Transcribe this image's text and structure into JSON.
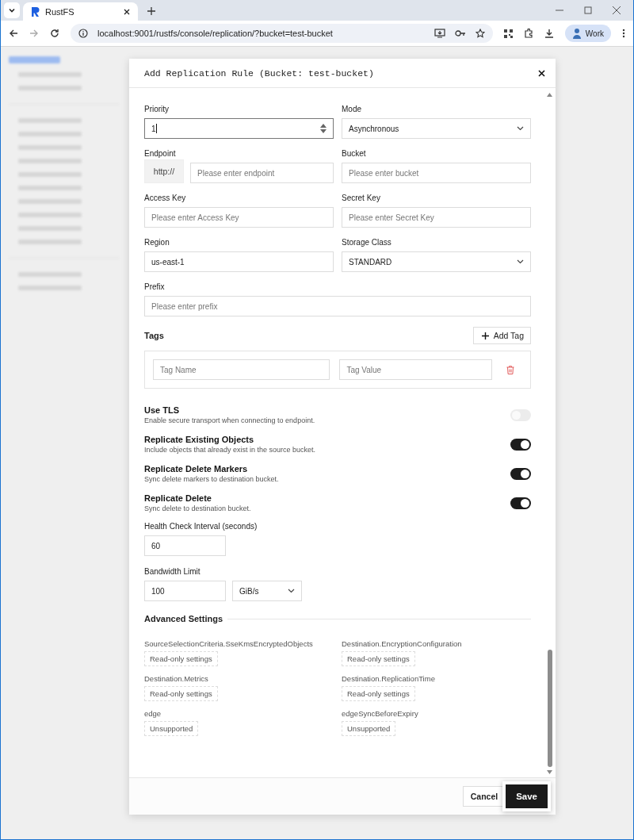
{
  "browser": {
    "tab_title": "RustFS",
    "url": "localhost:9001/rustfs/console/replication/?bucket=test-bucket",
    "profile": "Work"
  },
  "dialog": {
    "title": "Add Replication Rule (Bucket: test-bucket)",
    "field_rows": [
      [
        {
          "kind": "number",
          "label": "Priority",
          "value": "1"
        },
        {
          "kind": "select",
          "label": "Mode",
          "value": "Asynchronous"
        }
      ],
      [
        {
          "kind": "prefixed",
          "label": "Endpoint",
          "prefix": "http://",
          "placeholder": "Please enter endpoint"
        },
        {
          "kind": "text",
          "label": "Bucket",
          "placeholder": "Please enter bucket"
        }
      ],
      [
        {
          "kind": "text",
          "label": "Access Key",
          "placeholder": "Please enter Access Key"
        },
        {
          "kind": "text",
          "label": "Secret Key",
          "placeholder": "Please enter Secret Key"
        }
      ],
      [
        {
          "kind": "text",
          "label": "Region",
          "value": "us-east-1"
        },
        {
          "kind": "select",
          "label": "Storage Class",
          "value": "STANDARD"
        }
      ],
      [
        {
          "kind": "text",
          "label": "Prefix",
          "placeholder": "Please enter prefix"
        }
      ]
    ],
    "tags": {
      "title": "Tags",
      "add_button": "Add Tag",
      "rows": [
        {
          "name_placeholder": "Tag Name",
          "value_placeholder": "Tag Value"
        }
      ]
    },
    "toggles": [
      {
        "title": "Use TLS",
        "description": "Enable secure transport when connecting to endpoint.",
        "on": false
      },
      {
        "title": "Replicate Existing Objects",
        "description": "Include objects that already exist in the source bucket.",
        "on": true
      },
      {
        "title": "Replicate Delete Markers",
        "description": "Sync delete markers to destination bucket.",
        "on": true
      },
      {
        "title": "Replicate Delete",
        "description": "Sync delete to destination bucket.",
        "on": true
      }
    ],
    "health_check": {
      "label": "Health Check Interval (seconds)",
      "value": "60"
    },
    "bandwidth": {
      "label": "Bandwidth Limit",
      "value": "100",
      "unit": "GiB/s"
    },
    "advanced": {
      "title": "Advanced Settings",
      "items": [
        {
          "label": "SourceSelectionCriteria.SseKmsEncryptedObjects",
          "value": "Read-only settings"
        },
        {
          "label": "Destination.EncryptionConfiguration",
          "value": "Read-only settings"
        },
        {
          "label": "Destination.Metrics",
          "value": "Read-only settings"
        },
        {
          "label": "Destination.ReplicationTime",
          "value": "Read-only settings"
        },
        {
          "label": "edge",
          "value": "Unsupported"
        },
        {
          "label": "edgeSyncBeforeExpiry",
          "value": "Unsupported"
        }
      ]
    },
    "buttons": [
      {
        "kind": "secondary",
        "label": "Cancel"
      },
      {
        "kind": "primary",
        "label": "Save"
      }
    ]
  }
}
